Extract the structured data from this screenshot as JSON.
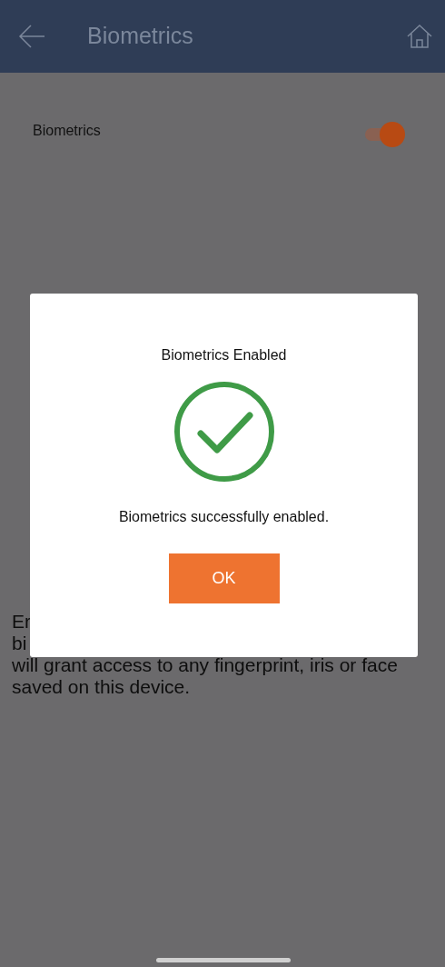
{
  "header": {
    "title": "Biometrics"
  },
  "setting": {
    "label": "Biometrics",
    "on": true
  },
  "description_lines": [
    "Er",
    "bi",
    "will grant access to any fingerprint, iris or face",
    "saved on this device."
  ],
  "dialog": {
    "title": "Biometrics Enabled",
    "message": "Biometrics successfully enabled.",
    "button": "OK"
  }
}
